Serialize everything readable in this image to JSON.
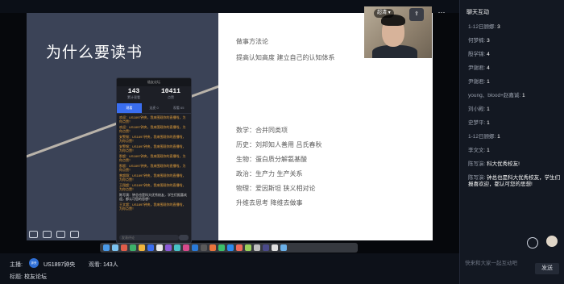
{
  "slide": {
    "title": "为什么要读书",
    "right_heading_1": "做事方法论",
    "right_heading_2": "提高认知高度 建立自己的认知体系",
    "lines": [
      "数学：合并同类项",
      "历史：刘邦知人善用 吕氏春秋",
      "生物：蛋白质分解氨基酸",
      "政治：生产力 生产关系",
      "物理：爱因斯坦 狭义相对论",
      "升维去思考 降维去做事"
    ]
  },
  "live_panel": {
    "header": "极友论坛",
    "stats": [
      {
        "num": "143",
        "label": "累计观看"
      },
      {
        "num": "10411",
        "label": "点赞"
      }
    ],
    "tabs": [
      "观看",
      "连麦 0",
      "观看 65"
    ],
    "messages": [
      "欢迎：US1897钟央，我来围观你的直播啦，为你点赞！",
      "欢迎：US1897钟央，我来围观你的直播啦，为你点赞！",
      "安警惕：US1897钟央，我来围观你的直播啦，为你点赞！",
      "安警惕：US1897钟央，我来围观你的直播啦，为你点赞！",
      "那超：US1897钟央，我来围观你的直播啦，为你点赞！",
      "那超：US1897钟央，我来围观你的直播啦，为你点赞！",
      "曾超翔：US1897钟央，我来围观你的直播啦，为你点赞！",
      "王翔超：US1897钟央，我来围观你的直播啦，为你点赞！",
      "陈写演：钟总也是科大优秀校友，学生们报喜欢迎，都认可您的思想！",
      "王文超：US1897钟央，我来围观你的直播啦，为你点赞！"
    ],
    "input_placeholder": "发表评论"
  },
  "webcam": {
    "name": "超清",
    "name_arrow": "▾"
  },
  "more_icon": "···",
  "info": {
    "host_label": "主播:",
    "host_avatar": "钟央",
    "host_name": "US1897钟央",
    "viewers_label": "观看:",
    "viewers": "143人",
    "topic_label": "标题:",
    "topic": "校友论坛"
  },
  "chat": {
    "title": "聊天互动",
    "messages": [
      {
        "user": "1-12日顾娜:",
        "text": "3"
      },
      {
        "user": "何梦楠:",
        "text": "3"
      },
      {
        "user": "殷学锦:",
        "text": "4"
      },
      {
        "user": "尹谢君:",
        "text": "4"
      },
      {
        "user": "尹谢君:",
        "text": "1"
      },
      {
        "user": "young、blood+赵嘉诚:",
        "text": "1"
      },
      {
        "user": "刘小殿:",
        "text": "1"
      },
      {
        "user": "史梦平:",
        "text": "1"
      },
      {
        "user": "1-12日顾娜:",
        "text": "1"
      },
      {
        "user": "李文文:",
        "text": "1"
      },
      {
        "user": "陈写演:",
        "text": "科大优秀校友!"
      },
      {
        "user": "陈写演:",
        "text": "钟总也是科大优秀校友，学生们报喜欢迎，都认可您的思想!"
      }
    ],
    "input_placeholder": "快来和大家一起互动吧",
    "send_label": "发送"
  },
  "colors": {
    "accent": "#3a6ef0",
    "warn_text": "#e7a23c"
  }
}
